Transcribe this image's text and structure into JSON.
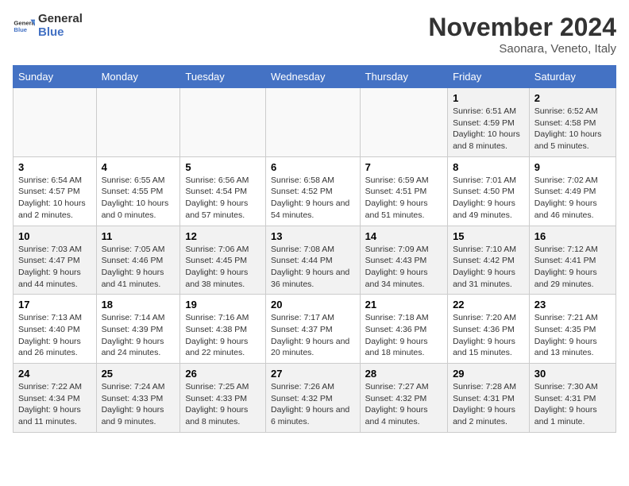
{
  "header": {
    "logo_general": "General",
    "logo_blue": "Blue",
    "main_title": "November 2024",
    "subtitle": "Saonara, Veneto, Italy"
  },
  "weekdays": [
    "Sunday",
    "Monday",
    "Tuesday",
    "Wednesday",
    "Thursday",
    "Friday",
    "Saturday"
  ],
  "weeks": [
    [
      {
        "day": "",
        "info": ""
      },
      {
        "day": "",
        "info": ""
      },
      {
        "day": "",
        "info": ""
      },
      {
        "day": "",
        "info": ""
      },
      {
        "day": "",
        "info": ""
      },
      {
        "day": "1",
        "info": "Sunrise: 6:51 AM\nSunset: 4:59 PM\nDaylight: 10 hours and 8 minutes."
      },
      {
        "day": "2",
        "info": "Sunrise: 6:52 AM\nSunset: 4:58 PM\nDaylight: 10 hours and 5 minutes."
      }
    ],
    [
      {
        "day": "3",
        "info": "Sunrise: 6:54 AM\nSunset: 4:57 PM\nDaylight: 10 hours and 2 minutes."
      },
      {
        "day": "4",
        "info": "Sunrise: 6:55 AM\nSunset: 4:55 PM\nDaylight: 10 hours and 0 minutes."
      },
      {
        "day": "5",
        "info": "Sunrise: 6:56 AM\nSunset: 4:54 PM\nDaylight: 9 hours and 57 minutes."
      },
      {
        "day": "6",
        "info": "Sunrise: 6:58 AM\nSunset: 4:52 PM\nDaylight: 9 hours and 54 minutes."
      },
      {
        "day": "7",
        "info": "Sunrise: 6:59 AM\nSunset: 4:51 PM\nDaylight: 9 hours and 51 minutes."
      },
      {
        "day": "8",
        "info": "Sunrise: 7:01 AM\nSunset: 4:50 PM\nDaylight: 9 hours and 49 minutes."
      },
      {
        "day": "9",
        "info": "Sunrise: 7:02 AM\nSunset: 4:49 PM\nDaylight: 9 hours and 46 minutes."
      }
    ],
    [
      {
        "day": "10",
        "info": "Sunrise: 7:03 AM\nSunset: 4:47 PM\nDaylight: 9 hours and 44 minutes."
      },
      {
        "day": "11",
        "info": "Sunrise: 7:05 AM\nSunset: 4:46 PM\nDaylight: 9 hours and 41 minutes."
      },
      {
        "day": "12",
        "info": "Sunrise: 7:06 AM\nSunset: 4:45 PM\nDaylight: 9 hours and 38 minutes."
      },
      {
        "day": "13",
        "info": "Sunrise: 7:08 AM\nSunset: 4:44 PM\nDaylight: 9 hours and 36 minutes."
      },
      {
        "day": "14",
        "info": "Sunrise: 7:09 AM\nSunset: 4:43 PM\nDaylight: 9 hours and 34 minutes."
      },
      {
        "day": "15",
        "info": "Sunrise: 7:10 AM\nSunset: 4:42 PM\nDaylight: 9 hours and 31 minutes."
      },
      {
        "day": "16",
        "info": "Sunrise: 7:12 AM\nSunset: 4:41 PM\nDaylight: 9 hours and 29 minutes."
      }
    ],
    [
      {
        "day": "17",
        "info": "Sunrise: 7:13 AM\nSunset: 4:40 PM\nDaylight: 9 hours and 26 minutes."
      },
      {
        "day": "18",
        "info": "Sunrise: 7:14 AM\nSunset: 4:39 PM\nDaylight: 9 hours and 24 minutes."
      },
      {
        "day": "19",
        "info": "Sunrise: 7:16 AM\nSunset: 4:38 PM\nDaylight: 9 hours and 22 minutes."
      },
      {
        "day": "20",
        "info": "Sunrise: 7:17 AM\nSunset: 4:37 PM\nDaylight: 9 hours and 20 minutes."
      },
      {
        "day": "21",
        "info": "Sunrise: 7:18 AM\nSunset: 4:36 PM\nDaylight: 9 hours and 18 minutes."
      },
      {
        "day": "22",
        "info": "Sunrise: 7:20 AM\nSunset: 4:36 PM\nDaylight: 9 hours and 15 minutes."
      },
      {
        "day": "23",
        "info": "Sunrise: 7:21 AM\nSunset: 4:35 PM\nDaylight: 9 hours and 13 minutes."
      }
    ],
    [
      {
        "day": "24",
        "info": "Sunrise: 7:22 AM\nSunset: 4:34 PM\nDaylight: 9 hours and 11 minutes."
      },
      {
        "day": "25",
        "info": "Sunrise: 7:24 AM\nSunset: 4:33 PM\nDaylight: 9 hours and 9 minutes."
      },
      {
        "day": "26",
        "info": "Sunrise: 7:25 AM\nSunset: 4:33 PM\nDaylight: 9 hours and 8 minutes."
      },
      {
        "day": "27",
        "info": "Sunrise: 7:26 AM\nSunset: 4:32 PM\nDaylight: 9 hours and 6 minutes."
      },
      {
        "day": "28",
        "info": "Sunrise: 7:27 AM\nSunset: 4:32 PM\nDaylight: 9 hours and 4 minutes."
      },
      {
        "day": "29",
        "info": "Sunrise: 7:28 AM\nSunset: 4:31 PM\nDaylight: 9 hours and 2 minutes."
      },
      {
        "day": "30",
        "info": "Sunrise: 7:30 AM\nSunset: 4:31 PM\nDaylight: 9 hours and 1 minute."
      }
    ]
  ]
}
